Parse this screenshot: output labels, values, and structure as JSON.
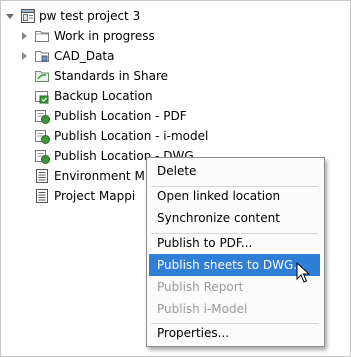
{
  "tree": {
    "root": {
      "label": "pw test project 3",
      "icon": "project-icon"
    },
    "items": [
      {
        "label": "Work in progress",
        "icon": "folder-icon",
        "expandable": true
      },
      {
        "label": "CAD_Data",
        "icon": "folder-db-icon",
        "expandable": true
      },
      {
        "label": "Standards in Share",
        "icon": "share-folder-icon",
        "expandable": false
      },
      {
        "label": "Backup Location",
        "icon": "backup-location-icon",
        "expandable": false
      },
      {
        "label": "Publish Location - PDF",
        "icon": "publish-location-icon",
        "expandable": false
      },
      {
        "label": "Publish Location - i-model",
        "icon": "publish-location-icon",
        "expandable": false
      },
      {
        "label": "Publish Location - DWG",
        "icon": "publish-location-icon",
        "expandable": false
      },
      {
        "label": "Environment M",
        "icon": "table-icon",
        "expandable": false
      },
      {
        "label": "Project Mappi",
        "icon": "table-icon",
        "expandable": false
      }
    ]
  },
  "context_menu": {
    "items": [
      {
        "label": "Delete",
        "state": "normal"
      },
      {
        "label": "Open linked location",
        "state": "normal"
      },
      {
        "label": "Synchronize content",
        "state": "normal"
      },
      {
        "label": "Publish to PDF...",
        "state": "normal"
      },
      {
        "label": "Publish sheets to DWG...",
        "state": "selected"
      },
      {
        "label": "Publish Report",
        "state": "disabled"
      },
      {
        "label": "Publish i-Model",
        "state": "disabled"
      },
      {
        "label": "Properties...",
        "state": "normal"
      }
    ]
  },
  "colors": {
    "highlight": "#2f7ed8",
    "disabled_text": "#9a9a9a",
    "folder": "#e8c76a",
    "location_green": "#3a9a3a"
  }
}
